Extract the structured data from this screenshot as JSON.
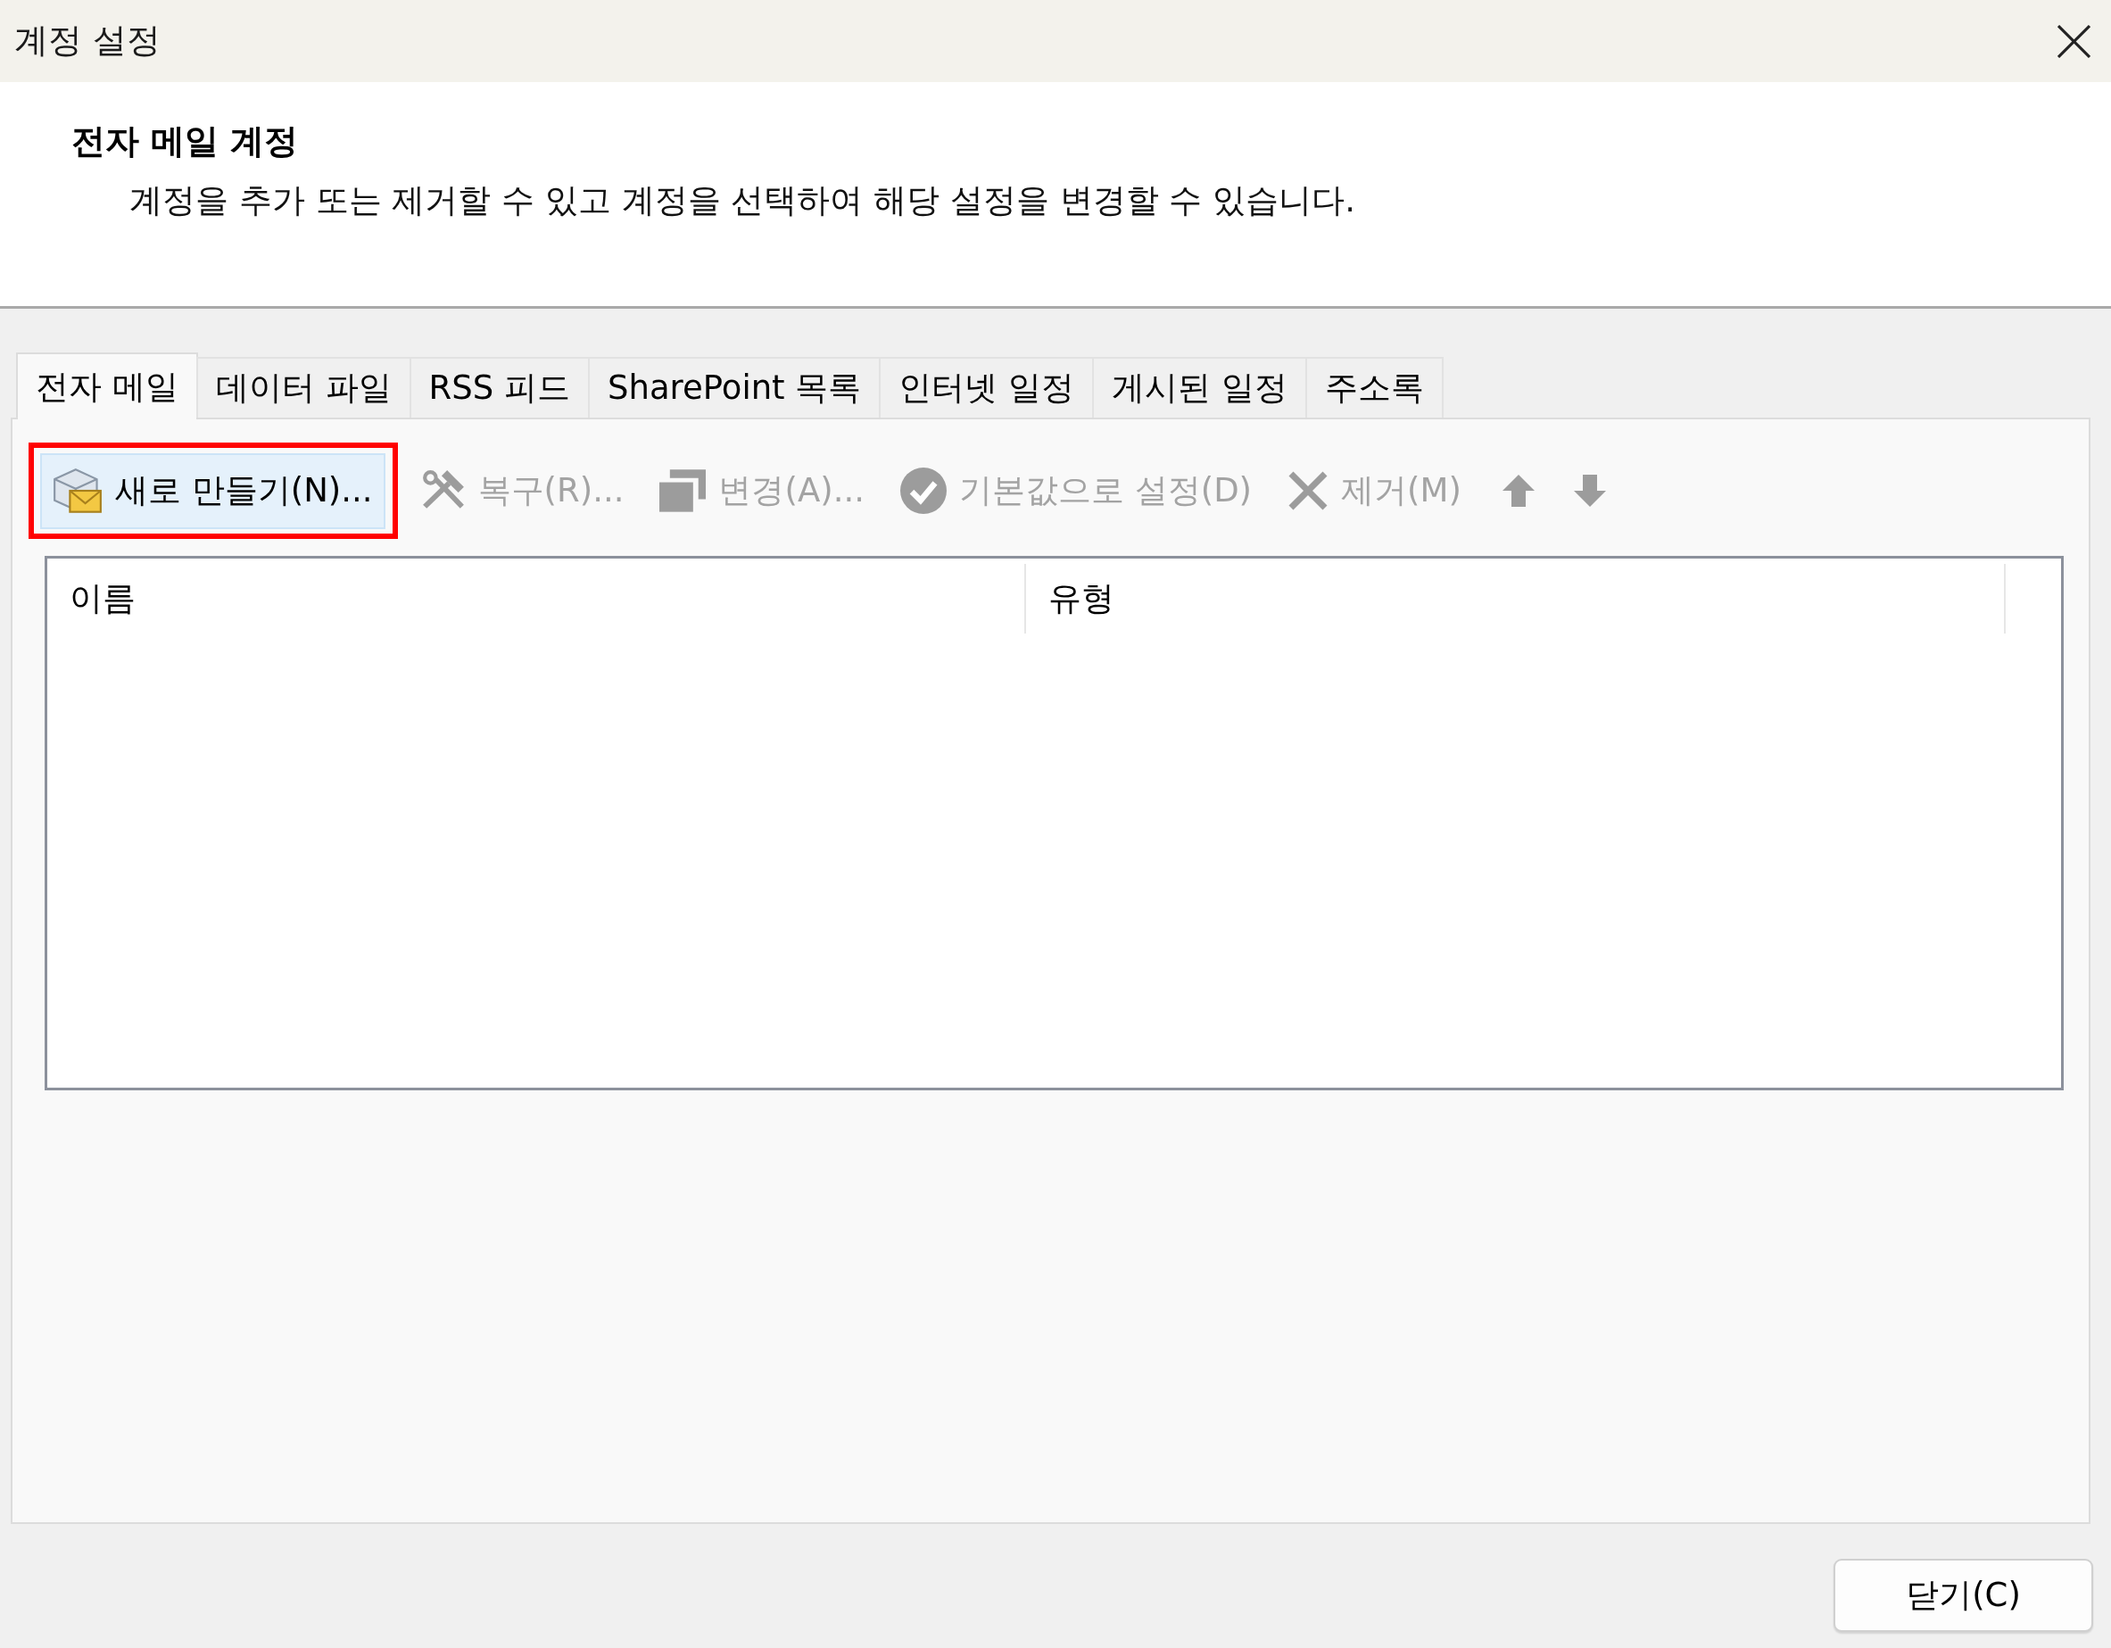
{
  "window": {
    "title": "계정 설정"
  },
  "header": {
    "title": "전자 메일 계정",
    "description": "계정을 추가 또는 제거할 수 있고 계정을 선택하여 해당 설정을 변경할 수 있습니다."
  },
  "tabs": [
    {
      "label": "전자 메일",
      "selected": true
    },
    {
      "label": "데이터 파일",
      "selected": false
    },
    {
      "label": "RSS 피드",
      "selected": false
    },
    {
      "label": "SharePoint 목록",
      "selected": false
    },
    {
      "label": "인터넷 일정",
      "selected": false
    },
    {
      "label": "게시된 일정",
      "selected": false
    },
    {
      "label": "주소록",
      "selected": false
    }
  ],
  "toolbar": {
    "buttons": [
      {
        "label": "새로 만들기(N)...",
        "disabled": false,
        "highlighted": true,
        "marked": true
      },
      {
        "label": "복구(R)...",
        "disabled": true,
        "highlighted": false,
        "marked": false
      },
      {
        "label": "변경(A)...",
        "disabled": true,
        "highlighted": false,
        "marked": false
      },
      {
        "label": "기본값으로 설정(D)",
        "disabled": true,
        "highlighted": false,
        "marked": false
      },
      {
        "label": "제거(M)",
        "disabled": true,
        "highlighted": false,
        "marked": false
      }
    ],
    "move_buttons": [
      {
        "kind": "up",
        "disabled": true
      },
      {
        "kind": "down",
        "disabled": true
      }
    ]
  },
  "table": {
    "columns": [
      "이름",
      "유형"
    ]
  },
  "close_button": {
    "label": "닫기(C)"
  }
}
